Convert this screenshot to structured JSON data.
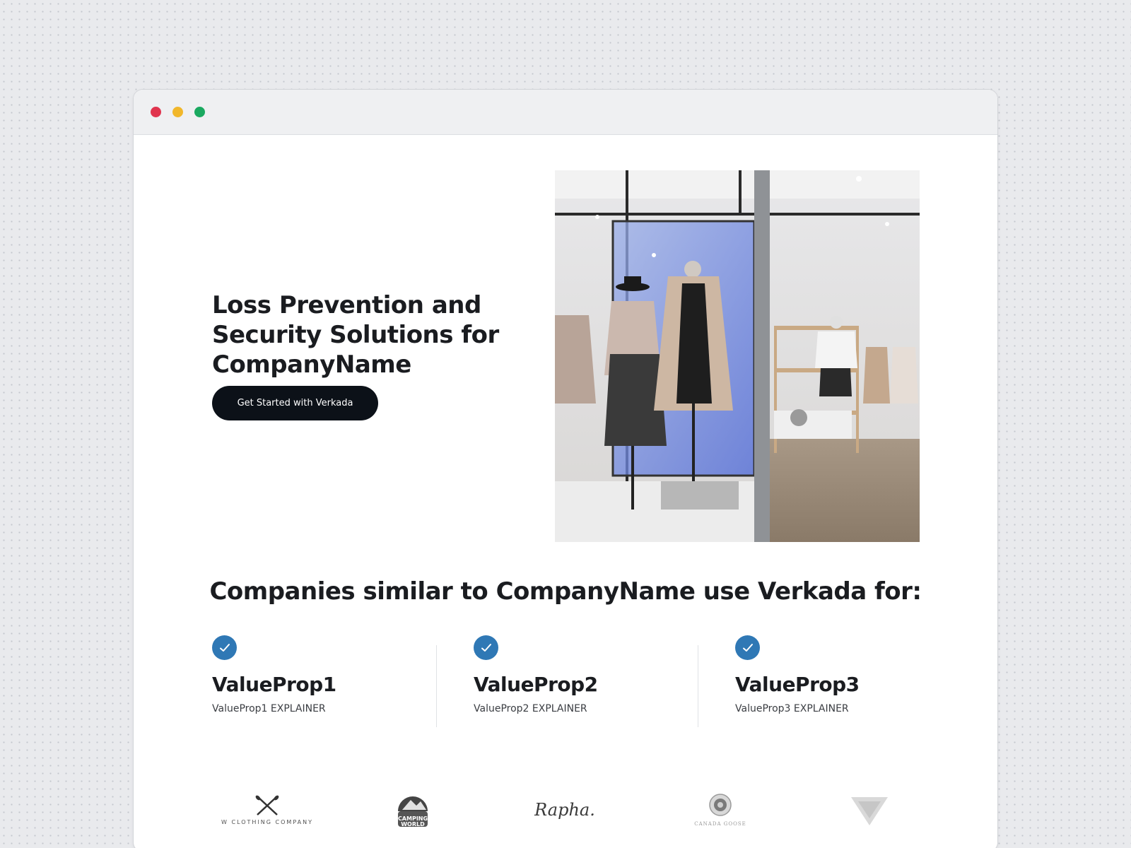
{
  "window": {
    "controls": [
      "close",
      "minimize",
      "maximize"
    ],
    "colors": {
      "close": "#e0344e",
      "minimize": "#f1b72b",
      "maximize": "#1aa960"
    }
  },
  "hero": {
    "title": "Loss Prevention and\nSecurity Solutions for\nCompanyName",
    "cta_label": "Get Started with Verkada",
    "image_alt": "retail clothing store interior with mannequins"
  },
  "section": {
    "title": "Companies similar to CompanyName use Verkada for:"
  },
  "value_props": [
    {
      "title": "ValueProp1",
      "explainer": "ValueProp1 EXPLAINER"
    },
    {
      "title": "ValueProp2",
      "explainer": "ValueProp2 EXPLAINER"
    },
    {
      "title": "ValueProp3",
      "explainer": "ValueProp3 EXPLAINER"
    }
  ],
  "logos": [
    {
      "icon": "crossed-paddles-logo",
      "text": "W CLOTHING COMPANY"
    },
    {
      "icon": "camping-world-logo",
      "text": "CAMPING WORLD"
    },
    {
      "icon": "rapha-logo",
      "text": "Rapha."
    },
    {
      "icon": "canada-goose-logo",
      "text": "CANADA GOOSE"
    },
    {
      "icon": "triangle-logo",
      "text": ""
    }
  ],
  "colors": {
    "accent": "#2f78b5",
    "cta_bg": "#0c1118",
    "text": "#1a1c20"
  }
}
